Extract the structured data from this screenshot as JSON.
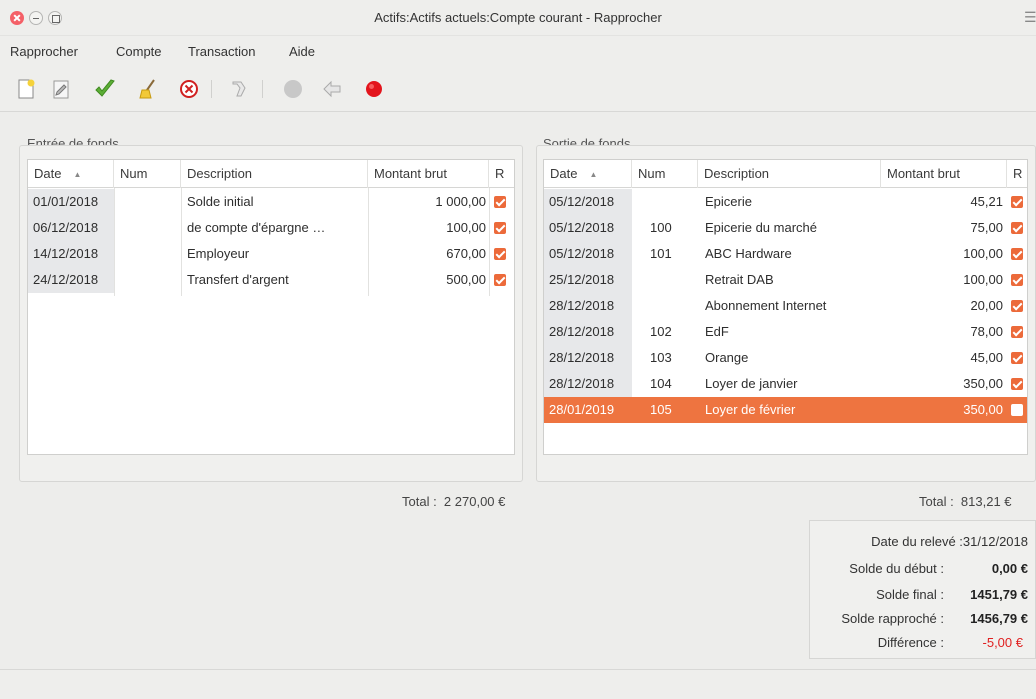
{
  "window": {
    "title": "Actifs:Actifs actuels:Compte courant - Rapprocher",
    "menu_icon": "hamburger-icon"
  },
  "menubar": [
    "Rapprocher",
    "Compte",
    "Transaction",
    "Aide"
  ],
  "toolbar": [
    "new-icon",
    "edit-icon",
    "check-icon",
    "broom-icon",
    "cancel-icon",
    "jump-icon",
    "circle-icon",
    "back-arrow-icon",
    "record-icon"
  ],
  "colors": {
    "accent": "#ee7440",
    "checkbox": "#ec6a3a",
    "negative": "#e02020"
  },
  "funds_in": {
    "title": "Entrée de fonds",
    "headers": {
      "date": "Date",
      "num": "Num",
      "desc": "Description",
      "amount": "Montant brut",
      "r": "R"
    },
    "rows": [
      {
        "date": "01/01/2018",
        "num": "",
        "desc": "Solde initial",
        "amount": "1 000,00",
        "r": true
      },
      {
        "date": "06/12/2018",
        "num": "",
        "desc": "de compte d'épargne …",
        "amount": "100,00",
        "r": true
      },
      {
        "date": "14/12/2018",
        "num": "",
        "desc": "Employeur",
        "amount": "670,00",
        "r": true
      },
      {
        "date": "24/12/2018",
        "num": "",
        "desc": "Transfert d'argent",
        "amount": "500,00",
        "r": true
      }
    ],
    "total_label": "Total :",
    "total_value": "2 270,00 €"
  },
  "funds_out": {
    "title": "Sortie de fonds",
    "headers": {
      "date": "Date",
      "num": "Num",
      "desc": "Description",
      "amount": "Montant brut",
      "r": "R"
    },
    "rows": [
      {
        "date": "05/12/2018",
        "num": "",
        "desc": "Epicerie",
        "amount": "45,21",
        "r": true
      },
      {
        "date": "05/12/2018",
        "num": "100",
        "desc": "Epicerie du marché",
        "amount": "75,00",
        "r": true
      },
      {
        "date": "05/12/2018",
        "num": "101",
        "desc": "ABC Hardware",
        "amount": "100,00",
        "r": true
      },
      {
        "date": "25/12/2018",
        "num": "",
        "desc": "Retrait DAB",
        "amount": "100,00",
        "r": true
      },
      {
        "date": "28/12/2018",
        "num": "",
        "desc": "Abonnement Internet",
        "amount": "20,00",
        "r": true
      },
      {
        "date": "28/12/2018",
        "num": "102",
        "desc": "EdF",
        "amount": "78,00",
        "r": true
      },
      {
        "date": "28/12/2018",
        "num": "103",
        "desc": "Orange",
        "amount": "45,00",
        "r": true
      },
      {
        "date": "28/12/2018",
        "num": "104",
        "desc": "Loyer de janvier",
        "amount": "350,00",
        "r": true
      },
      {
        "date": "28/01/2019",
        "num": "105",
        "desc": "Loyer de février",
        "amount": "350,00",
        "r": false,
        "selected": true
      }
    ],
    "total_label": "Total :",
    "total_value": "813,21 €"
  },
  "summary": {
    "statement_date_label": "Date du relevé :",
    "statement_date": "31/12/2018",
    "start_label": "Solde du début :",
    "start_value": "0,00 €",
    "final_label": "Solde final :",
    "final_value": "1451,79 €",
    "reconciled_label": "Solde rapproché :",
    "reconciled_value": "1456,79 €",
    "diff_label": "Différence :",
    "diff_value": "-5,00 €"
  }
}
